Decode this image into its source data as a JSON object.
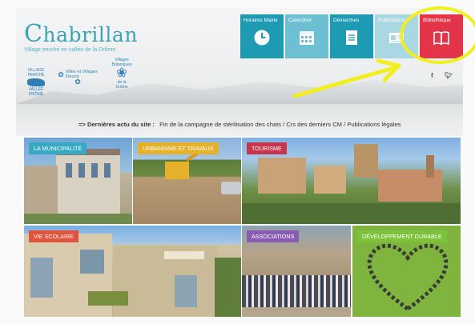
{
  "site": {
    "title": "Chabrillan",
    "title_cap": "C",
    "title_rest": "habrillan",
    "subtitle": "Village perché en vallée de la Drôme"
  },
  "badges": {
    "village_perche_line1": "VILLAGE",
    "village_perche_line2": "PERCHÉ",
    "village_perche_line3": "VALLÉE DRÔME",
    "villes_line1": "Villes et Villages",
    "villes_line2": "Fleuris",
    "botaniques_line1": "Villages",
    "botaniques_line2": "Botaniques",
    "botaniques_line3": "de la",
    "botaniques_line4": "Drôme"
  },
  "tiles": [
    {
      "label": "Horaires Mairie",
      "icon": "clock-icon",
      "color": "#1e9ab2"
    },
    {
      "label": "Calendrier",
      "icon": "calendar-icon",
      "color": "#6cc0d2"
    },
    {
      "label": "Démarches",
      "icon": "document-icon",
      "color": "#1e9ab2"
    },
    {
      "label": "Publications",
      "icon": "newspaper-icon",
      "color": "#a9d7e2"
    },
    {
      "label": "Bibliothèque",
      "icon": "book-icon",
      "color": "#e3344a"
    }
  ],
  "social": {
    "facebook": "f",
    "twitter": "t"
  },
  "news": {
    "prefix": "=> Dernières actu du site :",
    "text": "Fin de la campagne de stérilisation des chats / Crs des derniers CM / Publications légales"
  },
  "categories": [
    {
      "label": "LA MUNICIPALITÉ",
      "label_color": "#37a9c2"
    },
    {
      "label": "URBANISME ET TRAVAUX",
      "label_color": "#e6b12a"
    },
    {
      "label": "TOURISME",
      "label_color": "#c8364d"
    },
    {
      "label": "VIE SCOLAIRE",
      "label_color": "#e0543e"
    },
    {
      "label": "ASSOCIATIONS",
      "label_color": "#8a5bb0"
    },
    {
      "label": "DÉVELOPPEMENT DURABLE",
      "label_color": "#7ec23c"
    }
  ],
  "colors": {
    "accent": "#1e9ab2",
    "highlight": "#f2ee20",
    "library": "#e3344a"
  }
}
